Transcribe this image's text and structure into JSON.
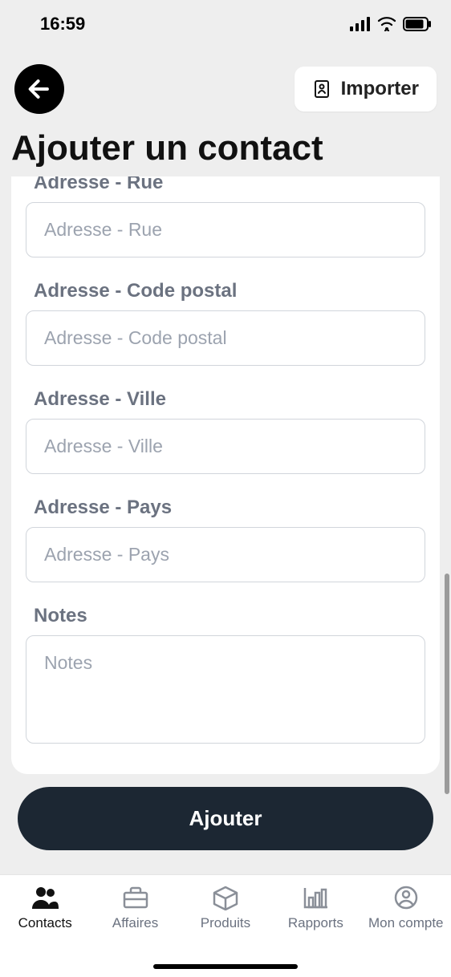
{
  "status": {
    "time": "16:59"
  },
  "header": {
    "import_label": "Importer",
    "page_title": "Ajouter un contact"
  },
  "form": {
    "street": {
      "label": "Adresse - Rue",
      "placeholder": "Adresse - Rue"
    },
    "postal": {
      "label": "Adresse - Code postal",
      "placeholder": "Adresse - Code postal"
    },
    "city": {
      "label": "Adresse - Ville",
      "placeholder": "Adresse - Ville"
    },
    "country": {
      "label": "Adresse - Pays",
      "placeholder": "Adresse - Pays"
    },
    "notes": {
      "label": "Notes",
      "placeholder": "Notes"
    }
  },
  "submit": {
    "label": "Ajouter"
  },
  "tabs": {
    "contacts": "Contacts",
    "affaires": "Affaires",
    "produits": "Produits",
    "rapports": "Rapports",
    "compte": "Mon compte"
  }
}
